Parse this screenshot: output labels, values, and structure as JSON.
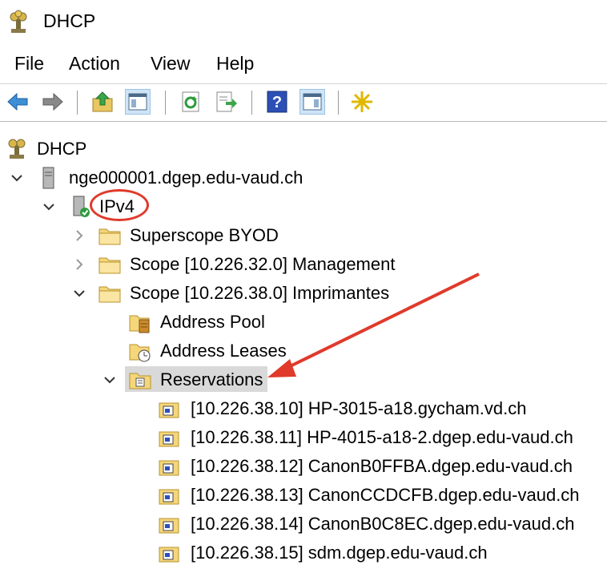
{
  "window": {
    "title": "DHCP",
    "icon": "dhcp-icon"
  },
  "menu": [
    "File",
    "Action",
    "View",
    "Help"
  ],
  "toolbar": {
    "buttons": [
      "back-icon",
      "forward-icon",
      "up-folder-icon",
      "show-hide-tree-icon",
      "refresh-icon",
      "export-list-icon",
      "help-icon",
      "show-hide-action-pane-icon",
      "new-icon"
    ]
  },
  "tree": {
    "root": "DHCP",
    "server": "nge000001.dgep.edu-vaud.ch",
    "ipv4": "IPv4",
    "superscope": "Superscope BYOD",
    "scope_management": "Scope [10.226.32.0] Management",
    "scope_printers": "Scope [10.226.38.0] Imprimantes",
    "address_pool": "Address Pool",
    "address_leases": "Address Leases",
    "reservations": "Reservations",
    "reservation_items": [
      "[10.226.38.10] HP-3015-a18.gycham.vd.ch",
      "[10.226.38.11] HP-4015-a18-2.dgep.edu-vaud.ch",
      "[10.226.38.12] CanonB0FFBA.dgep.edu-vaud.ch",
      "[10.226.38.13] CanonCCDCFB.dgep.edu-vaud.ch",
      "[10.226.38.14] CanonB0C8EC.dgep.edu-vaud.ch",
      "[10.226.38.15] sdm.dgep.edu-vaud.ch"
    ]
  },
  "annotations": {
    "color": "#e03a2b"
  }
}
